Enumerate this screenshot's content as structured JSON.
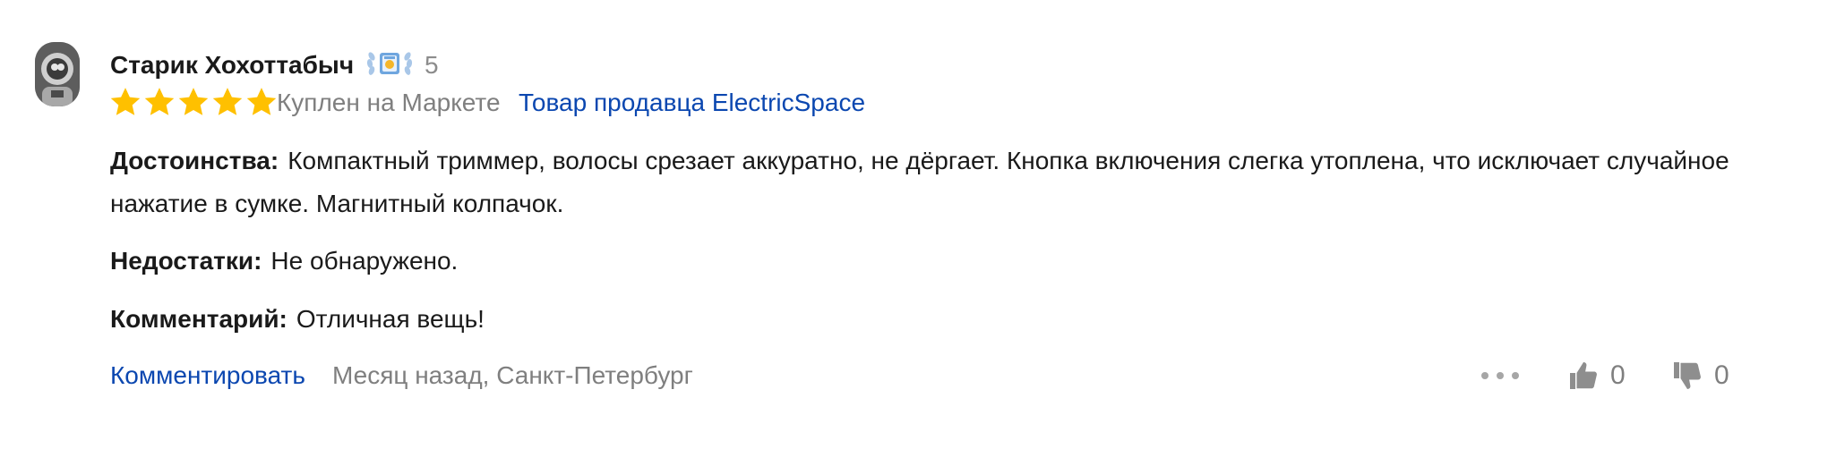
{
  "author": {
    "name": "Старик Хохоттабыч",
    "rank_count": "5",
    "avatar_icon": "astronaut-avatar"
  },
  "rating": {
    "value": 5,
    "max": 5,
    "star_color": "#ffc000"
  },
  "purchase_status": "Куплен на Маркете",
  "seller_link": "Товар продавца ElectricSpace",
  "sections": {
    "pros_label": "Достоинства:",
    "pros_text": "Компактный триммер, волосы срезает аккуратно, не дёргает. Кнопка включения слегка утоплена, что исключает случайное нажатие в сумке. Магнитный колпачок.",
    "cons_label": "Недостатки:",
    "cons_text": "Не обнаружено.",
    "comment_label": "Комментарий:",
    "comment_text": "Отличная вещь!"
  },
  "footer": {
    "comment_action": "Комментировать",
    "meta": "Месяц назад, Санкт-Петербург",
    "likes": "0",
    "dislikes": "0"
  },
  "colors": {
    "link": "#0b47b0",
    "muted": "#7f7f7f",
    "icon": "#9e9e9e"
  }
}
